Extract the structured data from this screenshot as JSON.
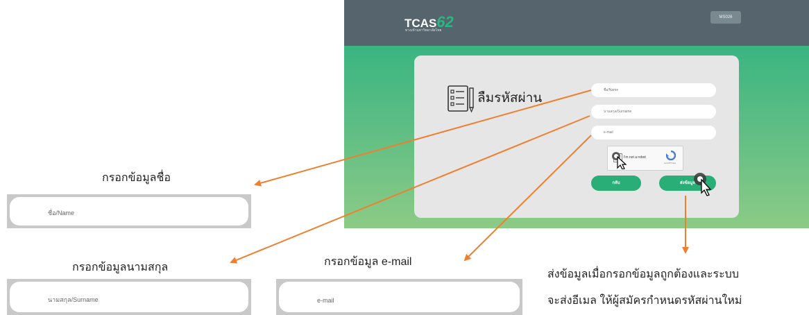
{
  "app": {
    "logo_text": "TCAS",
    "logo_number": "62",
    "logo_subtitle": "ทางเข้ามหาวิทยาลัยไทย",
    "top_button": "MS026"
  },
  "form": {
    "title": "ลืมรหัสผ่าน",
    "fields": [
      {
        "placeholder": "ชื่อ/Name"
      },
      {
        "placeholder": "นามสกุล/Surname"
      },
      {
        "placeholder": "e-mail"
      }
    ],
    "captcha": {
      "label": "I'm not a robot",
      "brand": "reCAPTCHA"
    },
    "back_button": "กลับ",
    "submit_button": "ส่งข้อมูล"
  },
  "annotations": {
    "name_label": "กรอกข้อมูลชื่อ",
    "surname_label": "กรอกข้อมูลนามสกุล",
    "email_label": "กรอกข้อมูล e-mail",
    "submit_desc_line1": "ส่งข้อมูลเมื่อกรอกข้อมูลถูกต้องและระบบ",
    "submit_desc_line2": "จะส่งอีเมล ให้ผู้สมัครกำหนดรหัสผ่านใหม่"
  },
  "zoomed_fields": {
    "name": "ชื่อ/Name",
    "surname": "นามสกุล/Surname",
    "email": "e-mail"
  },
  "colors": {
    "header": "#56656d",
    "accent": "#2aae78",
    "arrow": "#ef7f2f"
  }
}
